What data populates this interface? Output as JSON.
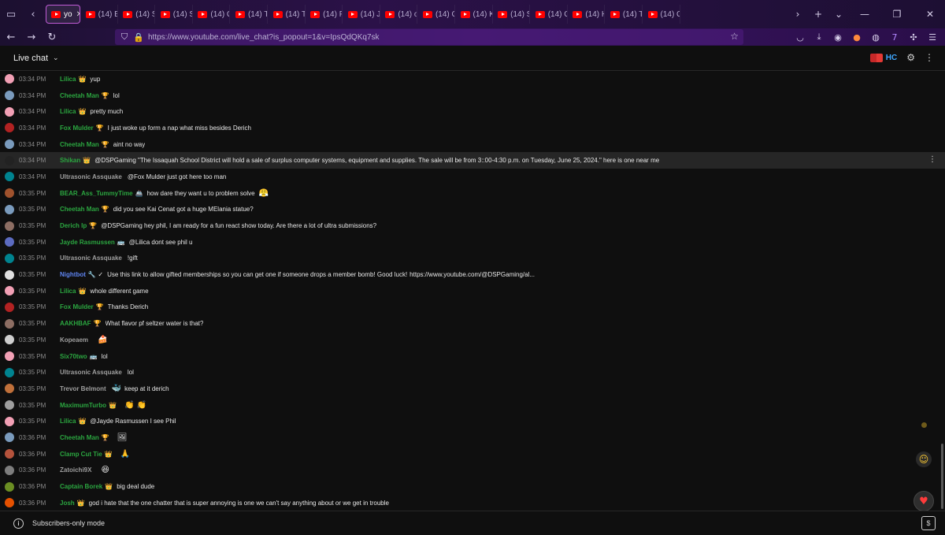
{
  "browser": {
    "active_tab_label": "yo",
    "tab_labels": [
      "(14) B",
      "(14) S",
      "(14) S",
      "(14) C",
      "(14) T",
      "(14) T",
      "(14) F",
      "(14) J",
      "(14) o",
      "(14) C",
      "(14) K",
      "(14) S",
      "(14) C",
      "(14) H",
      "(14) T",
      "(14) C"
    ],
    "url": "https://www.youtube.com/live_chat?is_popout=1&v=IpsQdQKq7sk"
  },
  "header": {
    "title": "Live chat",
    "hc_label": "HC"
  },
  "messages": [
    {
      "time": "03:34 PM",
      "author": "Lilica",
      "role": "member",
      "badge": "👑",
      "text": "yup",
      "avatar_color": "#f2a0b5"
    },
    {
      "time": "03:34 PM",
      "author": "Cheetah Man",
      "role": "member",
      "badge": "🏆",
      "text": "lol",
      "avatar_color": "#7a9bbd"
    },
    {
      "time": "03:34 PM",
      "author": "Lilica",
      "role": "member",
      "badge": "👑",
      "text": "pretty much",
      "avatar_color": "#f2a0b5"
    },
    {
      "time": "03:34 PM",
      "author": "Fox Mulder",
      "role": "member",
      "badge": "🏆",
      "text": "I just woke up form a nap what miss besides Derich",
      "avatar_color": "#b22222"
    },
    {
      "time": "03:34 PM",
      "author": "Cheetah Man",
      "role": "member",
      "badge": "🏆",
      "text": "aint no way",
      "avatar_color": "#7a9bbd"
    },
    {
      "time": "03:34 PM",
      "author": "Shikan",
      "role": "member",
      "badge": "👑",
      "text": "@DSPGaming \"The Issaquah School District will hold a sale of surplus computer systems, equipment and supplies. The sale will be from 3::00-4:30 p.m. on Tuesday, June 25, 2024.\" here is one near me",
      "avatar_color": "#222222",
      "highlight": true
    },
    {
      "time": "03:34 PM",
      "author": "Ultrasonic Assquake",
      "role": "nonmember",
      "badge": "",
      "text": "@Fox Mulder just got here too man",
      "avatar_color": "#00838f"
    },
    {
      "time": "03:35 PM",
      "author": "BEAR_Ass_TummyTime",
      "role": "member",
      "badge": "🚢",
      "text": "how dare they want u to problem solve",
      "avatar_color": "#a0522d",
      "emoji_after": "😤"
    },
    {
      "time": "03:35 PM",
      "author": "Cheetah Man",
      "role": "member",
      "badge": "🏆",
      "text": "did you see Kai Cenat got a huge MElania statue?",
      "avatar_color": "#7a9bbd"
    },
    {
      "time": "03:35 PM",
      "author": "Derich Ip",
      "role": "member",
      "badge": "🏆",
      "text": "@DSPGaming hey phil, I am ready for a fun react show today. Are there a lot of ultra submissions?",
      "avatar_color": "#8d6e63"
    },
    {
      "time": "03:35 PM",
      "author": "Jayde Rasmussen",
      "role": "member",
      "badge": "🚌",
      "text": "@Lilica dont see phil u",
      "avatar_color": "#5c6bc0"
    },
    {
      "time": "03:35 PM",
      "author": "Ultrasonic Assquake",
      "role": "nonmember",
      "badge": "",
      "text": "!gift",
      "avatar_color": "#00838f"
    },
    {
      "time": "03:35 PM",
      "author": "Nightbot",
      "role": "mod",
      "badge": "🔧 ✓",
      "text": "Use this link to allow gifted memberships so you can get one if someone drops a member bomb! Good luck!",
      "link": "https://www.youtube.com/@DSPGaming/al...",
      "avatar_color": "#e0e0e0"
    },
    {
      "time": "03:35 PM",
      "author": "Lilica",
      "role": "member",
      "badge": "👑",
      "text": "whole different game",
      "avatar_color": "#f2a0b5"
    },
    {
      "time": "03:35 PM",
      "author": "Fox Mulder",
      "role": "member",
      "badge": "🏆",
      "text": "Thanks Derich",
      "avatar_color": "#b22222"
    },
    {
      "time": "03:35 PM",
      "author": "AAKHBAF",
      "role": "member",
      "badge": "🏆",
      "text": "What flavor pf seltzer water is that?",
      "avatar_color": "#8d6e63"
    },
    {
      "time": "03:35 PM",
      "author": "Kopeaem",
      "role": "nonmember",
      "badge": "",
      "text": "",
      "avatar_color": "#cfcfcf",
      "emoji_after": "🍰"
    },
    {
      "time": "03:35 PM",
      "author": "Six70two",
      "role": "member",
      "badge": "🚌",
      "text": "lol",
      "avatar_color": "#f2a0b5"
    },
    {
      "time": "03:35 PM",
      "author": "Ultrasonic Assquake",
      "role": "nonmember",
      "badge": "",
      "text": "lol",
      "avatar_color": "#00838f"
    },
    {
      "time": "03:35 PM",
      "author": "Trevor Belmont",
      "role": "nonmember",
      "badge": "",
      "text": "keep at it derich",
      "avatar_color": "#c0703a",
      "emoji_before": "🐳"
    },
    {
      "time": "03:35 PM",
      "author": "MaximumTurbo",
      "role": "member",
      "badge": "👑",
      "text": "",
      "avatar_color": "#9e9e9e",
      "emoji_after": "👏 👏"
    },
    {
      "time": "03:35 PM",
      "author": "Lilica",
      "role": "member",
      "badge": "👑",
      "text": "@Jayde Rasmussen I see Phil",
      "avatar_color": "#f2a0b5"
    },
    {
      "time": "03:36 PM",
      "author": "Cheetah Man",
      "role": "member",
      "badge": "🏆",
      "text": "",
      "avatar_color": "#7a9bbd",
      "emoji_after": "🖼"
    },
    {
      "time": "03:36 PM",
      "author": "Clamp Cut Tie",
      "role": "member",
      "badge": "👑",
      "text": "",
      "avatar_color": "#b5533c",
      "emoji_after": "🙏"
    },
    {
      "time": "03:36 PM",
      "author": "Zatoichi9X",
      "role": "nonmember",
      "badge": "",
      "text": "",
      "avatar_color": "#7d7d7d",
      "emoji_after": "😆"
    },
    {
      "time": "03:36 PM",
      "author": "Captain Borek",
      "role": "member",
      "badge": "👑",
      "text": "big deal dude",
      "avatar_color": "#6b8e23"
    },
    {
      "time": "03:36 PM",
      "author": "Josh",
      "role": "member",
      "badge": "👑",
      "text": "god i hate that the one chatter that is super annoying is one we can't say anything about or we get in trouble",
      "avatar_color": "#e65100"
    }
  ],
  "footer": {
    "mode_text": "Subscribers-only mode"
  }
}
